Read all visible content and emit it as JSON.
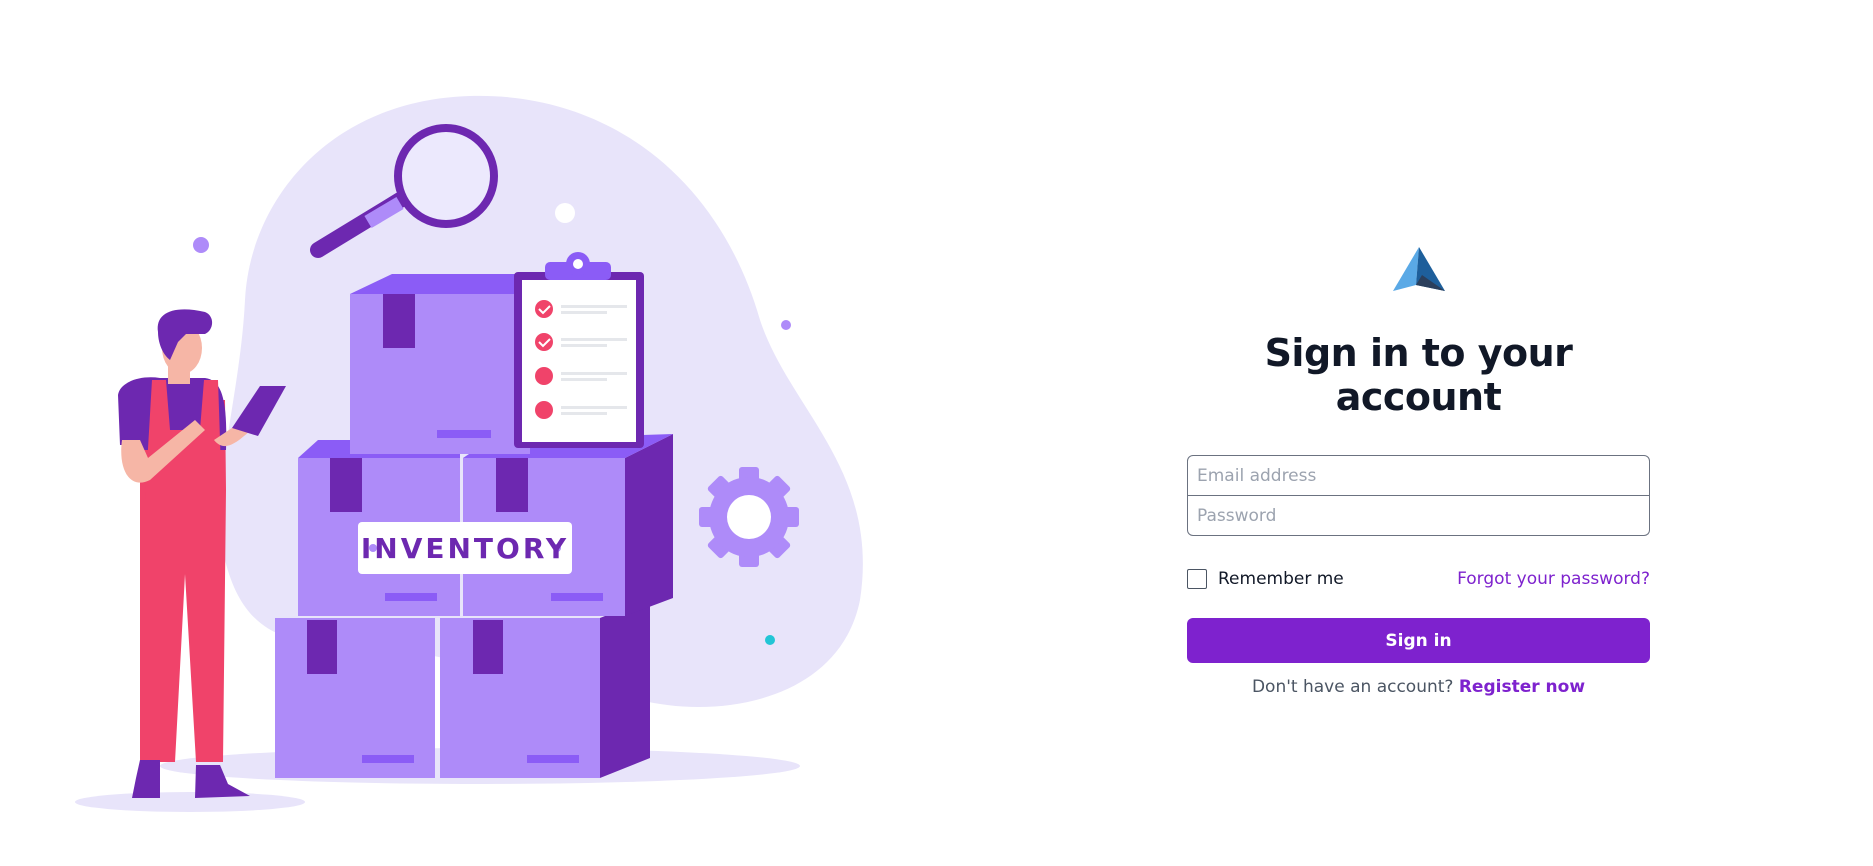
{
  "illustration": {
    "box_label": "INVENTORY"
  },
  "form": {
    "title": "Sign in to your account",
    "email_placeholder": "Email address",
    "password_placeholder": "Password",
    "remember_label": "Remember me",
    "forgot_link": "Forgot your password?",
    "signin_button": "Sign in",
    "register_prompt": "Don't have an account?",
    "register_link": "Register now"
  },
  "colors": {
    "accent": "#7e22ce",
    "title": "#111827",
    "muted_text": "#4b5563",
    "box_purple": "#ae8bf9",
    "box_dark": "#6d28b0",
    "blob": "#e8e4fa",
    "person_overalls": "#f0436a"
  },
  "icons": {
    "logo": "triangle-logo-icon",
    "checkbox": "checkbox-unchecked-icon"
  }
}
